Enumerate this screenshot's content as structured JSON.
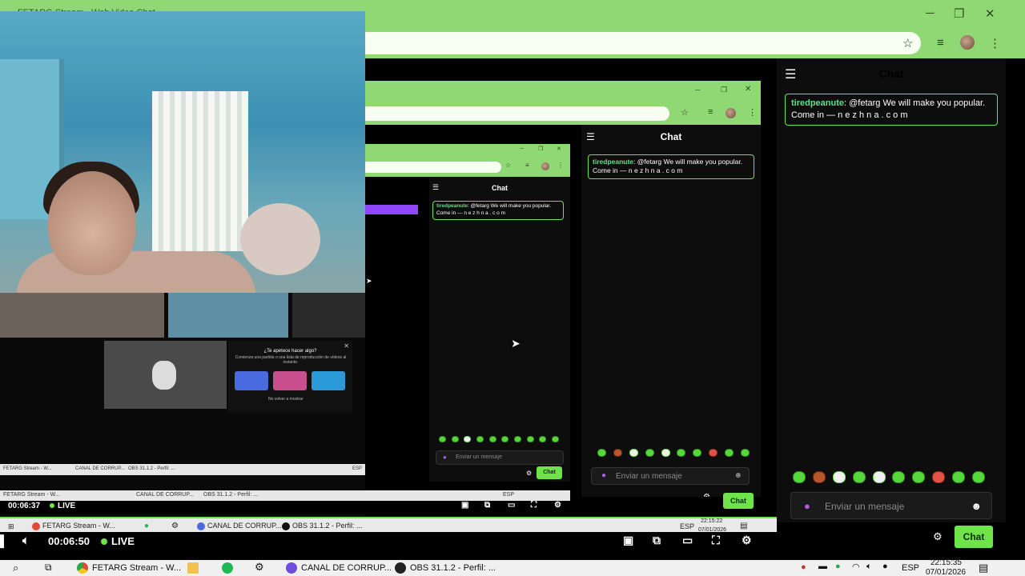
{
  "browser": {
    "tab_title": "FETARG Stream - Web Video Chat",
    "window_controls": {
      "minimize": "─",
      "maximize": "❐",
      "close": "✕"
    }
  },
  "chat": {
    "toggle_icon": "sidebar-toggle-icon",
    "header": "Chat",
    "messages": [
      {
        "user": "tiredpeanute",
        "text": ": @fetarg We will make you popular. Come in — n e z h n a . c o m"
      }
    ],
    "input_placeholder": "Enviar un mensaje",
    "send_label": "Chat",
    "emotes": [
      "green",
      "brown",
      "white",
      "green",
      "white",
      "green",
      "green",
      "red",
      "green",
      "green"
    ]
  },
  "popup": {
    "title": "¿Te apetece hacer algo?",
    "body": "Comienza una partida o una lista de reproducción de vídeos al instante.",
    "checkbox_label": "No volver a mostrar"
  },
  "player": {
    "time_main": "00:06:50",
    "time_nested": "00:06:37",
    "live_label": "LIVE"
  },
  "stream_taskbar": {
    "apps": [
      "FETARG Stream - W...",
      "CANAL DE CORRUP...",
      "OBS 31.1.2 - Perfil: ..."
    ],
    "lang": "ESP",
    "time": "22:15:22",
    "date": "07/01/2026"
  },
  "nested_taskbar": {
    "apps": [
      "FETARG Stream - W...",
      "CANAL DE CORRUP...",
      "OBS 31.1.2 - Perfil: ..."
    ],
    "lang": "ESP"
  },
  "taskbar": {
    "apps": [
      "FETARG Stream - W...",
      "CANAL DE CORRUP...",
      "OBS 31.1.2 - Perfil: ..."
    ],
    "lang": "ESP",
    "time": "22:15:35",
    "date": "07/01/2026"
  },
  "colors": {
    "accent": "#6fe34a",
    "chrome": "#8fd873",
    "username": "#5ee08a"
  }
}
